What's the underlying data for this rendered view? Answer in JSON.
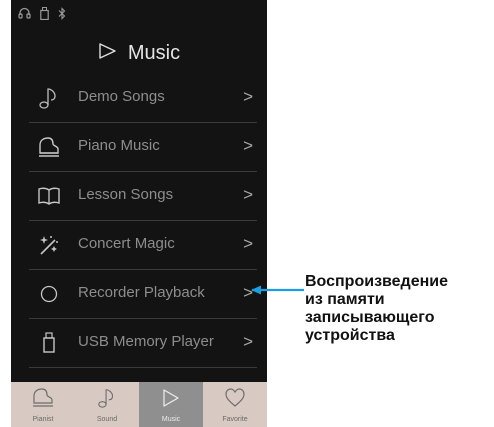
{
  "status_icons": [
    "headphones-icon",
    "usb-icon",
    "bluetooth-icon"
  ],
  "header": {
    "title": "Music",
    "icon": "play-outline-icon"
  },
  "menu": {
    "items": [
      {
        "label": "Demo Songs",
        "icon": "music-note-icon"
      },
      {
        "label": "Piano Music",
        "icon": "grand-piano-icon"
      },
      {
        "label": "Lesson Songs",
        "icon": "open-book-icon"
      },
      {
        "label": "Concert Magic",
        "icon": "magic-sparkle-icon"
      },
      {
        "label": "Recorder Playback",
        "icon": "circle-icon"
      },
      {
        "label": "USB Memory Player",
        "icon": "usb-drive-icon"
      }
    ],
    "chevron": ">"
  },
  "tabbar": {
    "tabs": [
      {
        "label": "Pianist",
        "icon": "grand-piano-icon"
      },
      {
        "label": "Sound",
        "icon": "music-note-icon"
      },
      {
        "label": "Music",
        "icon": "play-outline-icon",
        "active": true
      },
      {
        "label": "Favorite",
        "icon": "heart-icon"
      }
    ]
  },
  "callout": {
    "lines": [
      "Воспроизведение",
      "из памяти",
      "записывающего",
      "устройства"
    ],
    "color": "#1aa0e0"
  },
  "colors": {
    "screen_bg": "#131313",
    "tabbar_bg": "#d8c9c2",
    "tab_active_bg": "#8f8f8f"
  }
}
